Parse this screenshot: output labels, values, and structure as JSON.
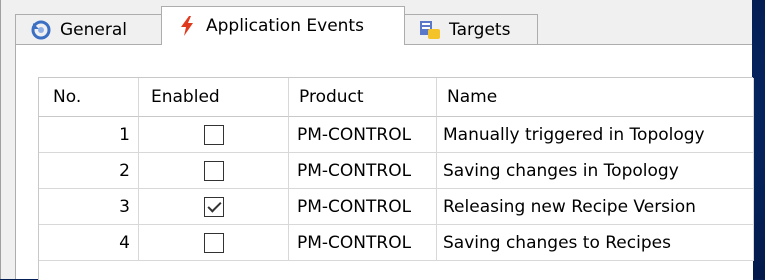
{
  "tabs": {
    "general": {
      "label": "General",
      "icon": "refresh-icon"
    },
    "events": {
      "label": "Application Events",
      "icon": "lightning-icon"
    },
    "targets": {
      "label": "Targets",
      "icon": "targets-icon"
    }
  },
  "colors": {
    "desktop_background": "#062766",
    "lightning": "#e03a1e",
    "refresh_icon": "#3a6fc4",
    "targets_icon_blue": "#5b78c8",
    "targets_icon_yellow": "#f3c329"
  },
  "table": {
    "columns": [
      "No.",
      "Enabled",
      "Product",
      "Name"
    ],
    "rows": [
      {
        "no": "1",
        "enabled": false,
        "product": "PM-CONTROL",
        "name": "Manually triggered in Topology"
      },
      {
        "no": "2",
        "enabled": false,
        "product": "PM-CONTROL",
        "name": "Saving changes in Topology"
      },
      {
        "no": "3",
        "enabled": true,
        "product": "PM-CONTROL",
        "name": "Releasing new Recipe Version"
      },
      {
        "no": "4",
        "enabled": false,
        "product": "PM-CONTROL",
        "name": "Saving changes to Recipes"
      }
    ]
  }
}
